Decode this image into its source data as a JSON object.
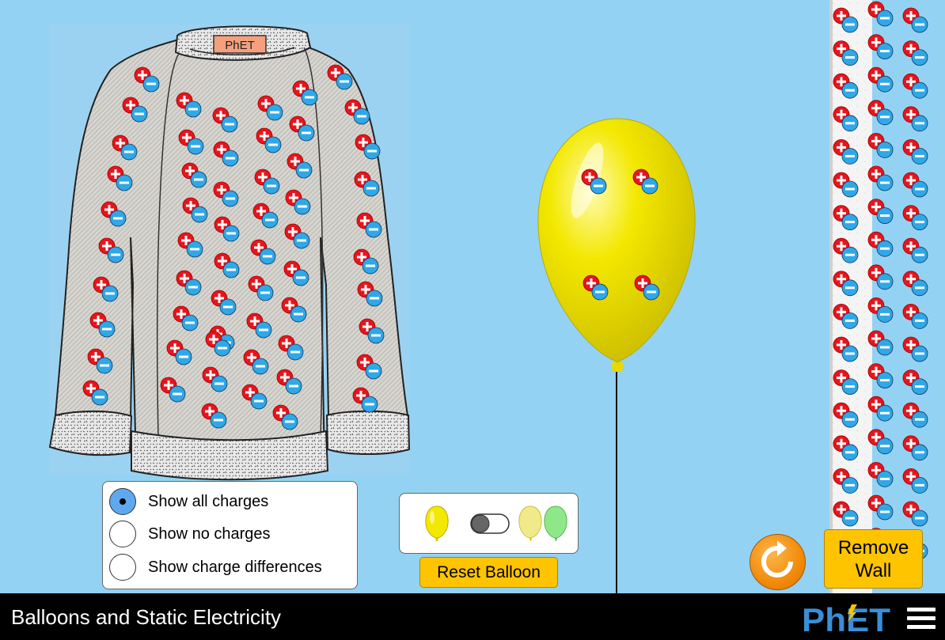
{
  "sim": {
    "title": "Balloons and Static Electricity"
  },
  "sweater": {
    "tag_text": "PhET"
  },
  "charge_display": {
    "options": [
      {
        "label": "Show all charges",
        "selected": true
      },
      {
        "label": "Show no charges",
        "selected": false
      },
      {
        "label": "Show charge differences",
        "selected": false
      }
    ]
  },
  "balloon_toggle": {
    "state": "off",
    "icons": [
      "yellow-balloon-icon",
      "yellow-and-green-balloons-icon"
    ]
  },
  "buttons": {
    "reset_balloon": "Reset Balloon",
    "remove_wall": "Remove Wall"
  },
  "colors": {
    "background": "#94d2f3",
    "positive_charge": "#e8141c",
    "negative_charge": "#2fa7e8",
    "balloon": "#f3e800",
    "button": "#fec400",
    "reset_all": "#ef8400"
  },
  "branding": {
    "logo_text": "PhET"
  }
}
